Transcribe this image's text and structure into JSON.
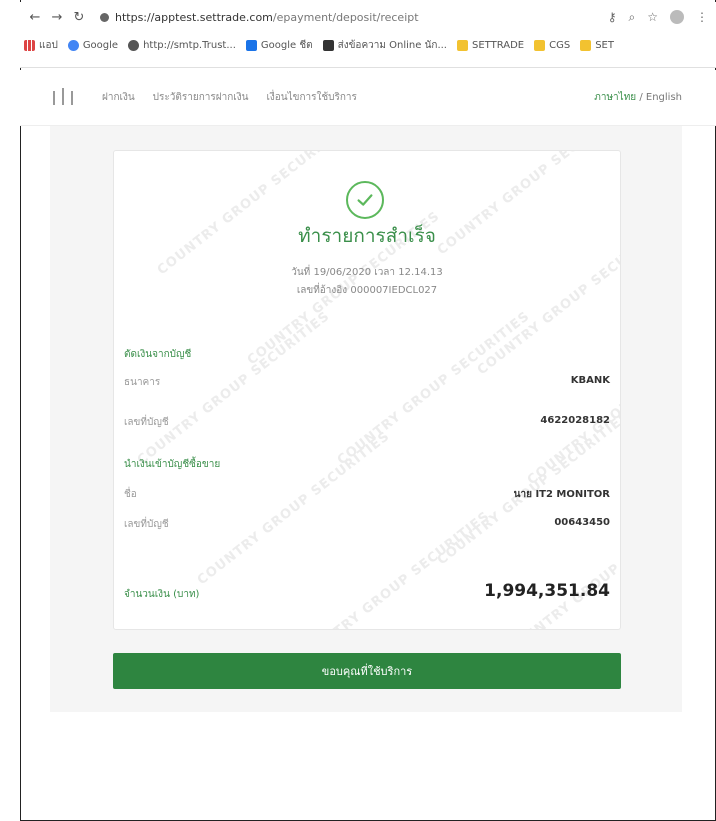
{
  "browser": {
    "url_host": "https://apptest.settrade.com",
    "url_path": "/epayment/deposit/receipt",
    "bookmarks": [
      {
        "label": "แอป",
        "icon": "apps-icon"
      },
      {
        "label": "Google",
        "icon": "google-icon"
      },
      {
        "label": "http://smtp.Trust...",
        "icon": "globe-icon"
      },
      {
        "label": "Google ชีต",
        "icon": "google-drive-icon"
      },
      {
        "label": "ส่งข้อความ Online นัก...",
        "icon": "dark-app-icon"
      },
      {
        "label": "SETTRADE",
        "icon": "folder-icon"
      },
      {
        "label": "CGS",
        "icon": "folder-icon"
      },
      {
        "label": "SET",
        "icon": "folder-icon"
      }
    ]
  },
  "site": {
    "nav": [
      "ฝากเงิน",
      "ประวัติรายการฝากเงิน",
      "เงื่อนไขการใช้บริการ"
    ],
    "lang_th": "ภาษาไทย",
    "lang_sep": " / ",
    "lang_en": "English"
  },
  "watermark_text": "COUNTRY GROUP SECURITIES",
  "receipt": {
    "title": "ทำรายการสำเร็จ",
    "date_line": "วันที่ 19/06/2020 เวลา 12.14.13",
    "ref_line": "เลขที่อ้างอิง 000007IEDCL027",
    "from_section": "ตัดเงินจากบัญชี",
    "bank_label": "ธนาคาร",
    "bank_value": "KBANK",
    "from_acct_label": "เลขที่บัญชี",
    "from_acct_value": "4622028182",
    "to_section": "นำเงินเข้าบัญชีซื้อขาย",
    "name_label": "ชื่อ",
    "name_value": "นาย IT2 MONITOR",
    "to_acct_label": "เลขที่บัญชี",
    "to_acct_value": "00643450",
    "amount_label": "จำนวนเงิน (บาท)",
    "amount_value": "1,994,351.84"
  },
  "confirm_button": "ขอบคุณที่ใช้บริการ"
}
